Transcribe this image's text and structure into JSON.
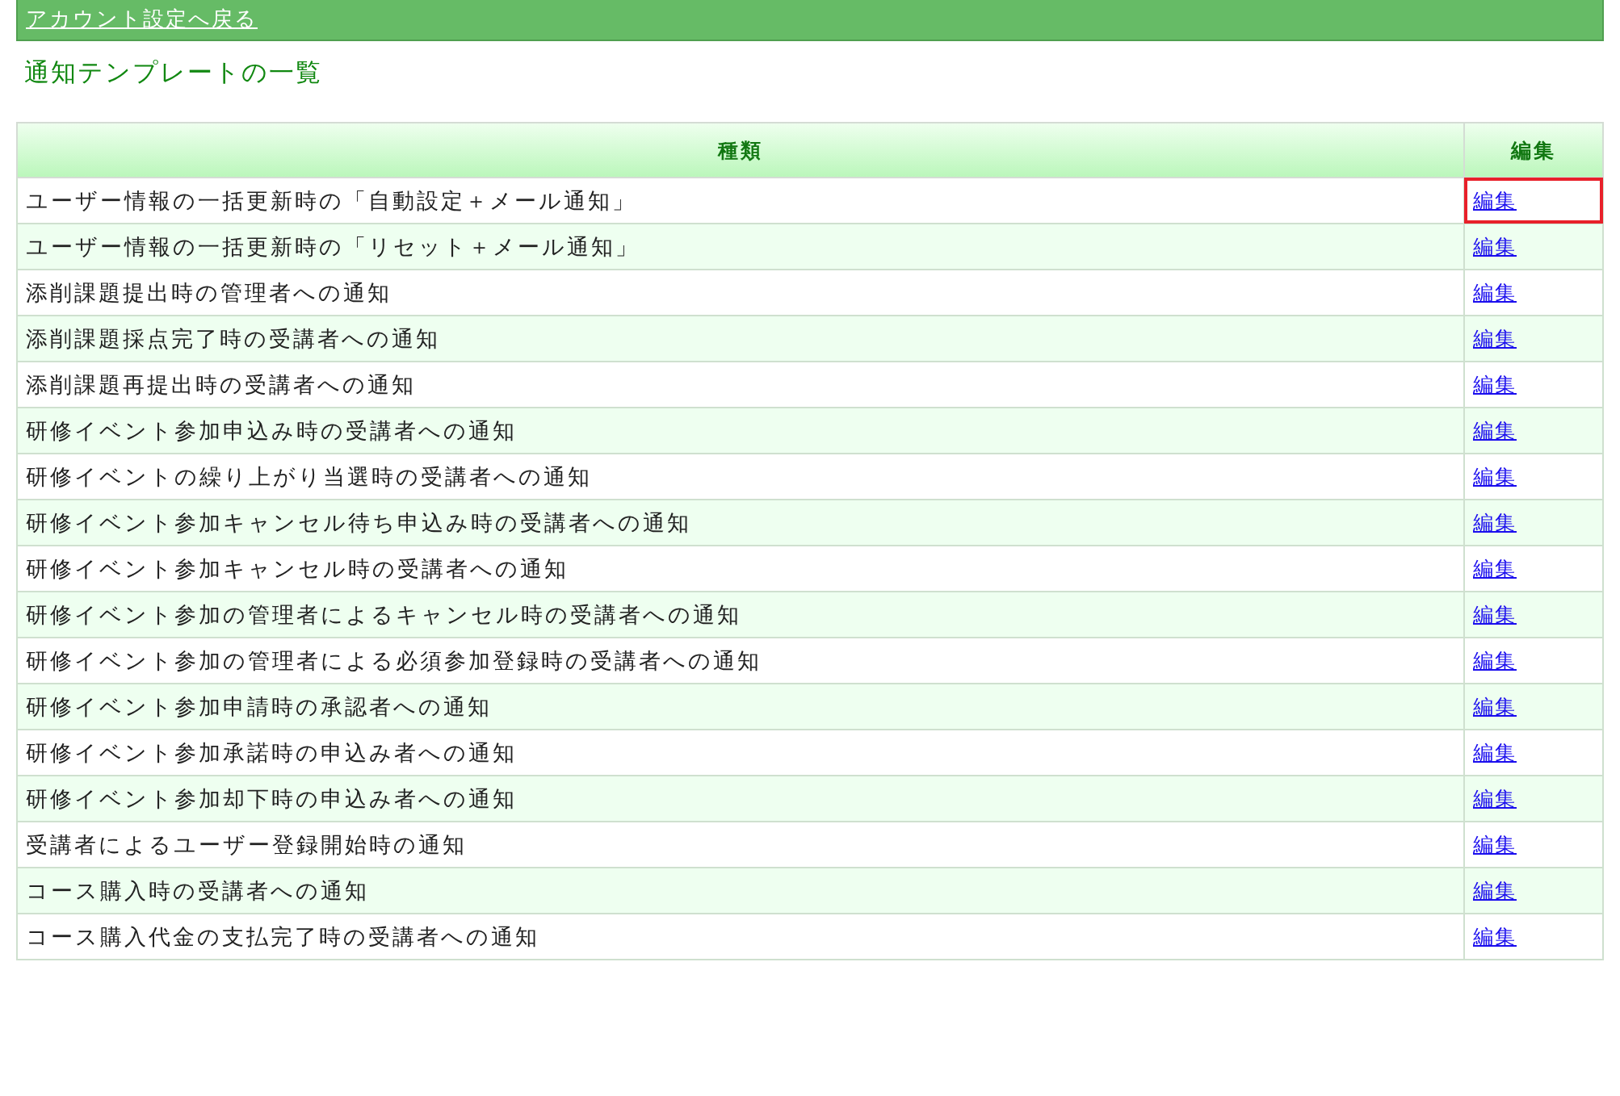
{
  "back_link": {
    "label": "アカウント設定へ戻る"
  },
  "heading": "通知テンプレートの一覧",
  "table": {
    "columns": [
      "種類",
      "編集"
    ],
    "rows": [
      {
        "type": "ユーザー情報の一括更新時の「自動設定＋メール通知」",
        "action": "編集",
        "highlighted": true
      },
      {
        "type": "ユーザー情報の一括更新時の「リセット＋メール通知」",
        "action": "編集",
        "highlighted": false
      },
      {
        "type": "添削課題提出時の管理者への通知",
        "action": "編集",
        "highlighted": false
      },
      {
        "type": "添削課題採点完了時の受講者への通知",
        "action": "編集",
        "highlighted": false
      },
      {
        "type": "添削課題再提出時の受講者への通知",
        "action": "編集",
        "highlighted": false
      },
      {
        "type": "研修イベント参加申込み時の受講者への通知",
        "action": "編集",
        "highlighted": false
      },
      {
        "type": "研修イベントの繰り上がり当選時の受講者への通知",
        "action": "編集",
        "highlighted": false
      },
      {
        "type": "研修イベント参加キャンセル待ち申込み時の受講者への通知",
        "action": "編集",
        "highlighted": false
      },
      {
        "type": "研修イベント参加キャンセル時の受講者への通知",
        "action": "編集",
        "highlighted": false
      },
      {
        "type": "研修イベント参加の管理者によるキャンセル時の受講者への通知",
        "action": "編集",
        "highlighted": false
      },
      {
        "type": "研修イベント参加の管理者による必須参加登録時の受講者への通知",
        "action": "編集",
        "highlighted": false
      },
      {
        "type": "研修イベント参加申請時の承認者への通知",
        "action": "編集",
        "highlighted": false
      },
      {
        "type": "研修イベント参加承諾時の申込み者への通知",
        "action": "編集",
        "highlighted": false
      },
      {
        "type": "研修イベント参加却下時の申込み者への通知",
        "action": "編集",
        "highlighted": false
      },
      {
        "type": "受講者によるユーザー登録開始時の通知",
        "action": "編集",
        "highlighted": false
      },
      {
        "type": "コース購入時の受講者への通知",
        "action": "編集",
        "highlighted": false
      },
      {
        "type": "コース購入代金の支払完了時の受講者への通知",
        "action": "編集",
        "highlighted": false
      }
    ]
  }
}
